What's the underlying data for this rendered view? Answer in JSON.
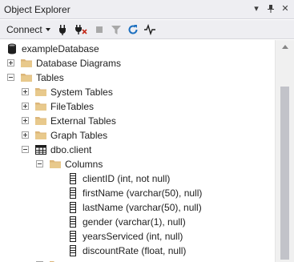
{
  "window": {
    "title": "Object Explorer",
    "pin_glyph": "▾",
    "autohide_glyph": "⊢",
    "close_glyph": "✕"
  },
  "toolbar": {
    "connect_label": "Connect",
    "icons": [
      "connect-icon",
      "disconnect-icon",
      "stop-icon",
      "filter-icon",
      "refresh-icon",
      "activity-monitor-icon"
    ]
  },
  "tree": {
    "items": [
      {
        "label": "exampleDatabase",
        "icon": "database-icon",
        "level": 0,
        "expander": "none"
      },
      {
        "label": "Database Diagrams",
        "icon": "folder-icon",
        "level": 1,
        "expander": "plus"
      },
      {
        "label": "Tables",
        "icon": "folder-icon",
        "level": 1,
        "expander": "minus"
      },
      {
        "label": "System Tables",
        "icon": "folder-icon",
        "level": 2,
        "expander": "plus"
      },
      {
        "label": "FileTables",
        "icon": "folder-icon",
        "level": 2,
        "expander": "plus"
      },
      {
        "label": "External Tables",
        "icon": "folder-icon",
        "level": 2,
        "expander": "plus"
      },
      {
        "label": "Graph Tables",
        "icon": "folder-icon",
        "level": 2,
        "expander": "plus"
      },
      {
        "label": "dbo.client",
        "icon": "table-icon",
        "level": 2,
        "expander": "minus"
      },
      {
        "label": "Columns",
        "icon": "folder-icon",
        "level": 3,
        "expander": "minus"
      },
      {
        "label": "clientID (int, not null)",
        "icon": "column-icon",
        "level": 4,
        "expander": "none"
      },
      {
        "label": "firstName (varchar(50), null)",
        "icon": "column-icon",
        "level": 4,
        "expander": "none"
      },
      {
        "label": "lastName (varchar(50), null)",
        "icon": "column-icon",
        "level": 4,
        "expander": "none"
      },
      {
        "label": "gender (varchar(1), null)",
        "icon": "column-icon",
        "level": 4,
        "expander": "none"
      },
      {
        "label": "yearsServiced (int, null)",
        "icon": "column-icon",
        "level": 4,
        "expander": "none"
      },
      {
        "label": "discountRate (float, null)",
        "icon": "column-icon",
        "level": 4,
        "expander": "none"
      },
      {
        "label": "",
        "icon": "folder-icon",
        "level": 3,
        "expander": "plus"
      }
    ]
  },
  "colors": {
    "folder": "#dcb67a",
    "chrome": "#eeeef2",
    "accent": "#1c6fbf"
  }
}
